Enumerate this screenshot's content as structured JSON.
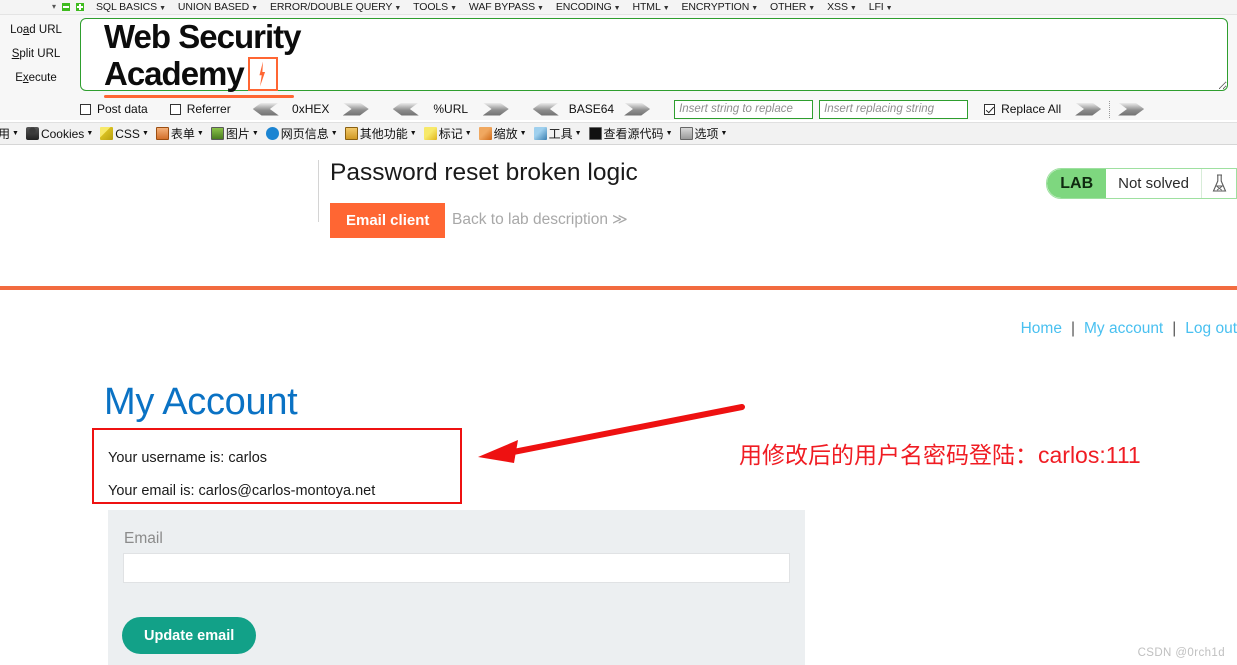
{
  "hackbar": {
    "menu_items": [
      {
        "label": "SQL BASICS"
      },
      {
        "label": "UNION BASED"
      },
      {
        "label": "ERROR/DOUBLE QUERY"
      },
      {
        "label": "TOOLS"
      },
      {
        "label": "WAF BYPASS"
      },
      {
        "label": "ENCODING"
      },
      {
        "label": "HTML"
      },
      {
        "label": "ENCRYPTION"
      },
      {
        "label": "OTHER"
      },
      {
        "label": "XSS"
      },
      {
        "label": "LFI"
      }
    ],
    "side_buttons": [
      {
        "label": "Load URL",
        "accel": "a"
      },
      {
        "label": "Split URL",
        "accel": "S"
      },
      {
        "label": "Execute",
        "accel": "x"
      }
    ],
    "url_value": "",
    "post_data_label": "Post data",
    "post_data_checked": false,
    "referrer_label": "Referrer",
    "referrer_checked": false,
    "codecs": [
      "0xHEX",
      "%URL",
      "BASE64"
    ],
    "replace_from_placeholder": "Insert string to replace",
    "replace_to_placeholder": "Insert replacing string",
    "replace_from_value": "",
    "replace_to_value": "",
    "replace_all_label": "Replace All",
    "replace_all_checked": true
  },
  "webdev_toolbar": {
    "items": [
      {
        "label": "禁用",
        "icon": "disable-icon",
        "truncated": true
      },
      {
        "label": "Cookies",
        "icon": "person-icon"
      },
      {
        "label": "CSS",
        "icon": "pen-icon"
      },
      {
        "label": "表单",
        "icon": "clipboard-icon"
      },
      {
        "label": "图片",
        "icon": "image-icon"
      },
      {
        "label": "网页信息",
        "icon": "info-icon"
      },
      {
        "label": "其他功能",
        "icon": "book-icon"
      },
      {
        "label": "标记",
        "icon": "marker-icon"
      },
      {
        "label": "缩放",
        "icon": "zoom-icon"
      },
      {
        "label": "工具",
        "icon": "tools-icon"
      },
      {
        "label": "查看源代码",
        "icon": "source-icon"
      },
      {
        "label": "选项",
        "icon": "options-icon"
      }
    ]
  },
  "lab": {
    "logo_line1": "Web Security",
    "logo_line2": "Academy",
    "title": "Password reset broken logic",
    "email_client_label": "Email client",
    "back_label": "Back to lab description",
    "back_chevron": "≫",
    "status_tag": "LAB",
    "status_state": "Not solved",
    "status_color": "#7ed77f"
  },
  "account": {
    "nav": [
      {
        "label": "Home"
      },
      {
        "label": "My account"
      },
      {
        "label": "Log out"
      }
    ],
    "nav_separator": "|",
    "heading": "My Account",
    "username_line": "Your username is: carlos",
    "email_line": "Your email is: carlos@carlos-montoya.net",
    "form": {
      "label": "Email",
      "value": "",
      "button_label": "Update email"
    }
  },
  "annotations": {
    "note_text": "用修改后的用户名密码登陆：carlos:111",
    "note_color": "#f01c23",
    "highlight_box_color": "#ee1111",
    "arrow_color": "#ee1111"
  },
  "watermark": {
    "text": "CSDN @0rch1d"
  }
}
